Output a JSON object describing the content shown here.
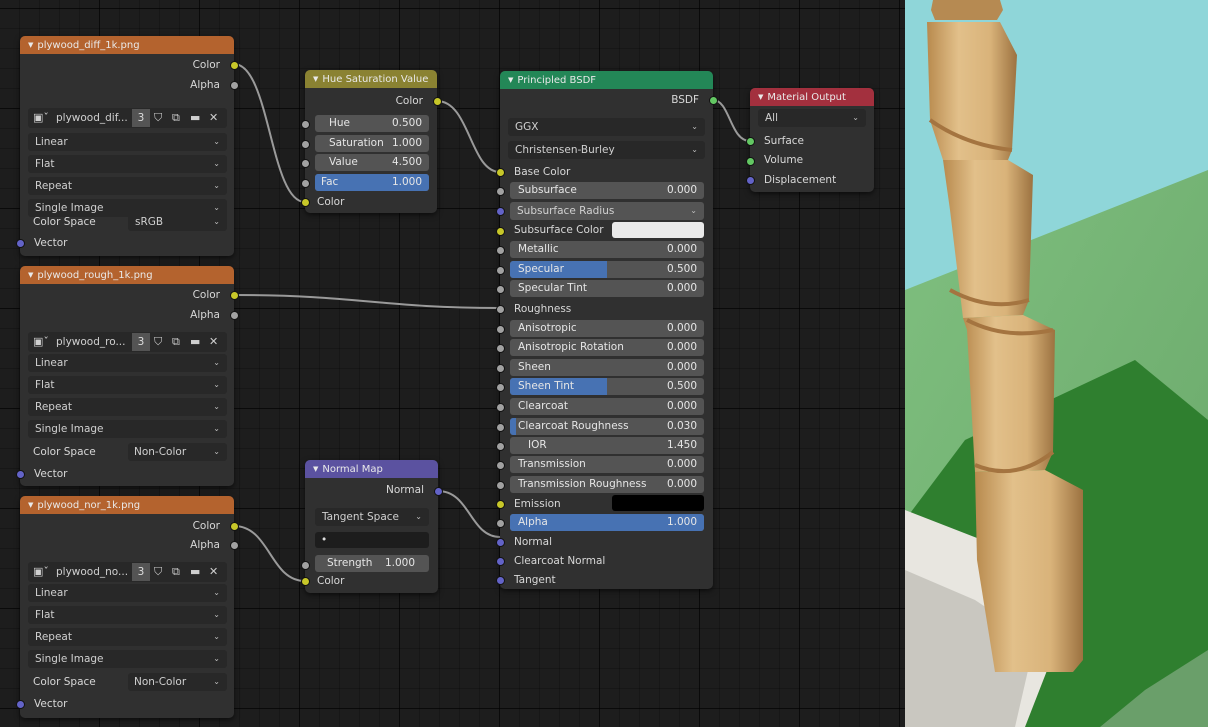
{
  "nodes": {
    "diff": {
      "title": "plywood_diff_1k.png",
      "outputs": [
        "Color",
        "Alpha"
      ],
      "image_name": "plywood_dif...",
      "users": "3",
      "interpolation": "Linear",
      "projection": "Flat",
      "extension": "Repeat",
      "source": "Single Image",
      "color_space_label": "Color Space",
      "color_space": "sRGB",
      "vector": "Vector"
    },
    "rough": {
      "title": "plywood_rough_1k.png",
      "outputs": [
        "Color",
        "Alpha"
      ],
      "image_name": "plywood_ro...",
      "users": "3",
      "interpolation": "Linear",
      "projection": "Flat",
      "extension": "Repeat",
      "source": "Single Image",
      "color_space_label": "Color Space",
      "color_space": "Non-Color",
      "vector": "Vector"
    },
    "nor": {
      "title": "plywood_nor_1k.png",
      "outputs": [
        "Color",
        "Alpha"
      ],
      "image_name": "plywood_no...",
      "users": "3",
      "interpolation": "Linear",
      "projection": "Flat",
      "extension": "Repeat",
      "source": "Single Image",
      "color_space_label": "Color Space",
      "color_space": "Non-Color",
      "vector": "Vector"
    },
    "hsv": {
      "title": "Hue Saturation Value",
      "output": "Color",
      "hue_label": "Hue",
      "hue": "0.500",
      "sat_label": "Saturation",
      "sat": "1.000",
      "val_label": "Value",
      "val": "4.500",
      "fac_label": "Fac",
      "fac": "1.000",
      "color_in": "Color"
    },
    "normalmap": {
      "title": "Normal Map",
      "output": "Normal",
      "space": "Tangent Space",
      "uvmap": "•",
      "strength_label": "Strength",
      "strength": "1.000",
      "color_in": "Color"
    },
    "bsdf": {
      "title": "Principled BSDF",
      "output": "BSDF",
      "distribution": "GGX",
      "subsurface_method": "Christensen-Burley",
      "base_color": "Base Color",
      "subsurface_label": "Subsurface",
      "subsurface": "0.000",
      "subsurface_radius": "Subsurface Radius",
      "subsurface_color": "Subsurface Color",
      "metallic_label": "Metallic",
      "metallic": "0.000",
      "specular_label": "Specular",
      "specular": "0.500",
      "specular_tint_label": "Specular Tint",
      "specular_tint": "0.000",
      "roughness": "Roughness",
      "anisotropic_label": "Anisotropic",
      "anisotropic": "0.000",
      "aniso_rot_label": "Anisotropic Rotation",
      "aniso_rot": "0.000",
      "sheen_label": "Sheen",
      "sheen": "0.000",
      "sheen_tint_label": "Sheen Tint",
      "sheen_tint": "0.500",
      "clearcoat_label": "Clearcoat",
      "clearcoat": "0.000",
      "clearcoat_rough_label": "Clearcoat Roughness",
      "clearcoat_rough": "0.030",
      "ior_label": "IOR",
      "ior": "1.450",
      "transmission_label": "Transmission",
      "transmission": "0.000",
      "trans_rough_label": "Transmission Roughness",
      "trans_rough": "0.000",
      "emission": "Emission",
      "alpha_label": "Alpha",
      "alpha": "1.000",
      "normal": "Normal",
      "clearcoat_normal": "Clearcoat Normal",
      "tangent": "Tangent"
    },
    "output": {
      "title": "Material Output",
      "target": "All",
      "surface": "Surface",
      "volume": "Volume",
      "displacement": "Displacement"
    }
  },
  "colors": {
    "image_header": "#b4632e",
    "color_header": "#8a8232",
    "shader_header": "#238757",
    "output_header": "#a3303e",
    "vector_header": "#5b52a0",
    "socket_color": "#c7c729",
    "socket_float": "#a1a1a1",
    "socket_vector": "#6363c7",
    "socket_shader": "#63c763",
    "slider_fill": "#4772b3",
    "subsurface_color": "#eaeaea",
    "emission_color": "#000000"
  },
  "icons": [
    "image-icon",
    "fake-user-shield-icon",
    "duplicate-icon",
    "open-folder-icon",
    "unlink-x-icon",
    "chevron-down-icon",
    "node-collapse-triangle-icon"
  ]
}
